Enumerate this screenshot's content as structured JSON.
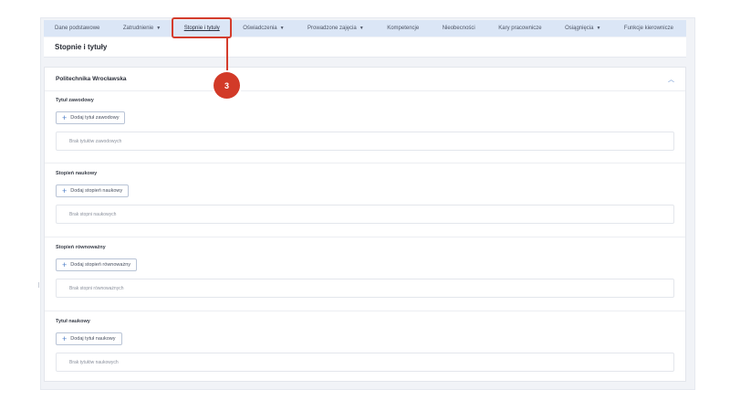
{
  "nav": {
    "items": [
      {
        "label": "Dane podstawowe",
        "dropdown": false,
        "active": false
      },
      {
        "label": "Zatrudnienie",
        "dropdown": true,
        "active": false
      },
      {
        "label": "Stopnie i tytuły",
        "dropdown": false,
        "active": true
      },
      {
        "label": "Oświadczenia",
        "dropdown": true,
        "active": false
      },
      {
        "label": "Prowadzone zajęcia",
        "dropdown": true,
        "active": false
      },
      {
        "label": "Kompetencje",
        "dropdown": false,
        "active": false
      },
      {
        "label": "Nieobecności",
        "dropdown": false,
        "active": false
      },
      {
        "label": "Kary pracownicze",
        "dropdown": false,
        "active": false
      },
      {
        "label": "Osiągnięcia",
        "dropdown": true,
        "active": false
      },
      {
        "label": "Funkcje kierownicze",
        "dropdown": false,
        "active": false
      }
    ]
  },
  "page_title": "Stopnie i tytuły",
  "callout": {
    "number": "3",
    "color": "#d23a28"
  },
  "organization": {
    "name": "Politechnika Wrocławska",
    "collapse_icon": "chevron-up-icon"
  },
  "sections": [
    {
      "title": "Tytuł zawodowy",
      "add_label": "Dodaj tytuł zawodowy",
      "empty_text": "Brak tytułów zawodowych"
    },
    {
      "title": "Stopień naukowy",
      "add_label": "Dodaj stopień naukowy",
      "empty_text": "Brak stopni naukowych"
    },
    {
      "title": "Stopień równoważny",
      "add_label": "Dodaj stopień równoważny",
      "empty_text": "Brak stopni równoważnych"
    },
    {
      "title": "Tytuł naukowy",
      "add_label": "Dodaj tytuł naukowy",
      "empty_text": "Brak tytułów naukowych"
    }
  ],
  "colors": {
    "nav_bg": "#dbe6f6",
    "accent": "#4f7fc7",
    "highlight": "#d43c2c"
  }
}
